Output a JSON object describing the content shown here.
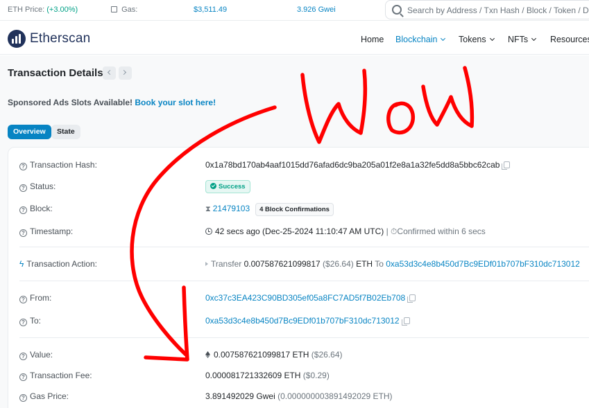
{
  "topbar": {
    "eth_price_label": "ETH Price:",
    "eth_price_value": "$3,511.49",
    "eth_price_change": "(+3.00%)",
    "gas_label": "Gas:",
    "gas_value": "3.926 Gwei",
    "search_placeholder": "Search by Address / Txn Hash / Block / Token / D"
  },
  "header": {
    "brand": "Etherscan",
    "nav": [
      "Home",
      "Blockchain",
      "Tokens",
      "NFTs",
      "Resources"
    ]
  },
  "page": {
    "title": "Transaction Details",
    "ads_text": "Sponsored Ads Slots Available!",
    "ads_link": "Book your slot here!",
    "tabs": [
      "Overview",
      "State"
    ]
  },
  "details": {
    "tx_hash_label": "Transaction Hash:",
    "tx_hash": "0x1a78bd170ab4aaf1015dd76afad6dc9ba205a01f2e8a1a32fe5dd8a5bbc62cab",
    "status_label": "Status:",
    "status": "Success",
    "block_label": "Block:",
    "block": "21479103",
    "confirmations": "4 Block Confirmations",
    "timestamp_label": "Timestamp:",
    "timestamp": "42 secs ago (Dec-25-2024 11:10:47 AM UTC)",
    "confirmed_within": "Confirmed within 6 secs",
    "action_label": "Transaction Action:",
    "action_prefix": "Transfer",
    "action_amount": "0.007587621099817",
    "action_usd": "($26.64)",
    "action_unit": "ETH",
    "action_to": "To",
    "action_to_addr": "0xa53d3c4e8b450d7Bc9EDf01b707bF310dc713012",
    "from_label": "From:",
    "from": "0xc37c3EA423C90BD305ef05a8FC7AD5f7B02Eb708",
    "to_label": "To:",
    "to": "0xa53d3c4e8b450d7Bc9EDf01b707bF310dc713012",
    "value_label": "Value:",
    "value": "0.007587621099817 ETH",
    "value_usd": "($26.64)",
    "fee_label": "Transaction Fee:",
    "fee": "0.000081721332609 ETH",
    "fee_usd": "($0.29)",
    "gas_price_label": "Gas Price:",
    "gas_price": "3.891492029 Gwei",
    "gas_price_eth": "(0.000000003891492029 ETH)"
  },
  "colors": {
    "accent": "#0784c3",
    "success": "#00a186",
    "annotation": "#ff0000"
  }
}
